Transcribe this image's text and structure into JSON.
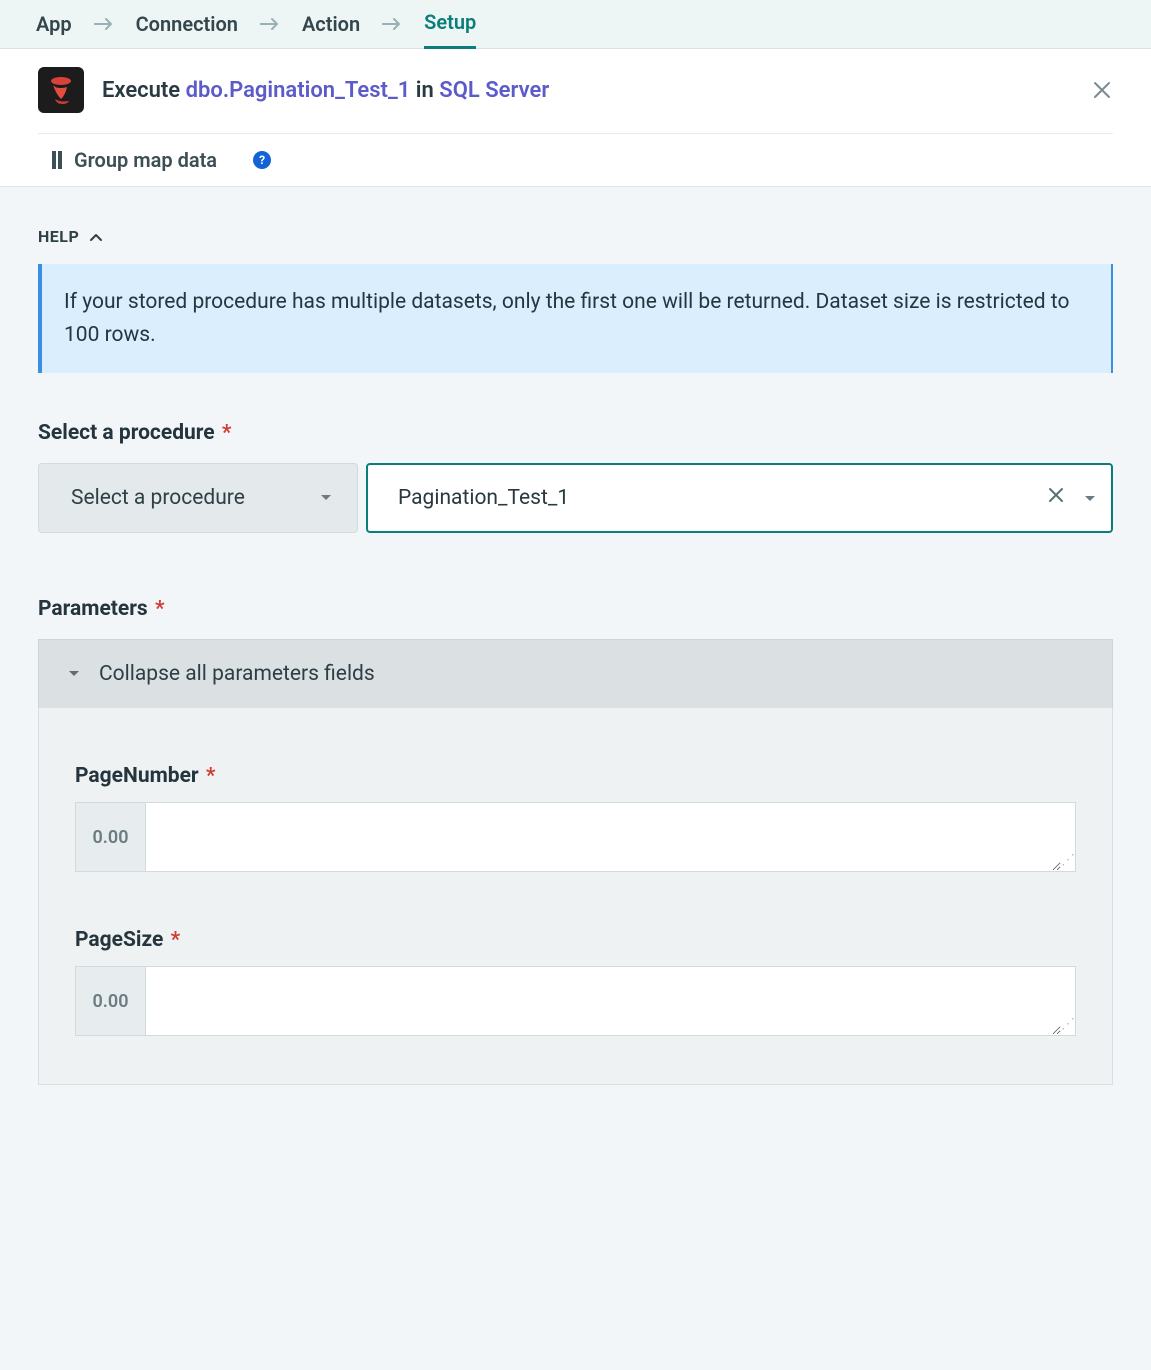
{
  "colors": {
    "accent_teal": "#0a7e7a",
    "link": "#5b5bca",
    "required": "#d43a2f"
  },
  "topbar": {
    "steps": [
      "App",
      "Connection",
      "Action",
      "Setup"
    ],
    "active_index": 3
  },
  "title": {
    "verb": "Execute",
    "procedure": "dbo.Pagination_Test_1",
    "join": "in",
    "app": "SQL Server",
    "icon_name": "sql-server-icon"
  },
  "groupmap": {
    "label": "Group map data"
  },
  "help": {
    "label": "HELP",
    "expanded": true,
    "banner": "If your stored procedure has multiple datasets, only the first one will be returned. Dataset size is restricted to 100 rows."
  },
  "procedure_field": {
    "label": "Select a procedure",
    "required": true,
    "selector_label": "Select a procedure",
    "value": "Pagination_Test_1"
  },
  "parameters": {
    "label": "Parameters",
    "required": true,
    "collapse_label": "Collapse all parameters fields",
    "items": [
      {
        "key": "PageNumber",
        "required": true,
        "prefix": "0.00",
        "value": ""
      },
      {
        "key": "PageSize",
        "required": true,
        "prefix": "0.00",
        "value": ""
      }
    ]
  }
}
